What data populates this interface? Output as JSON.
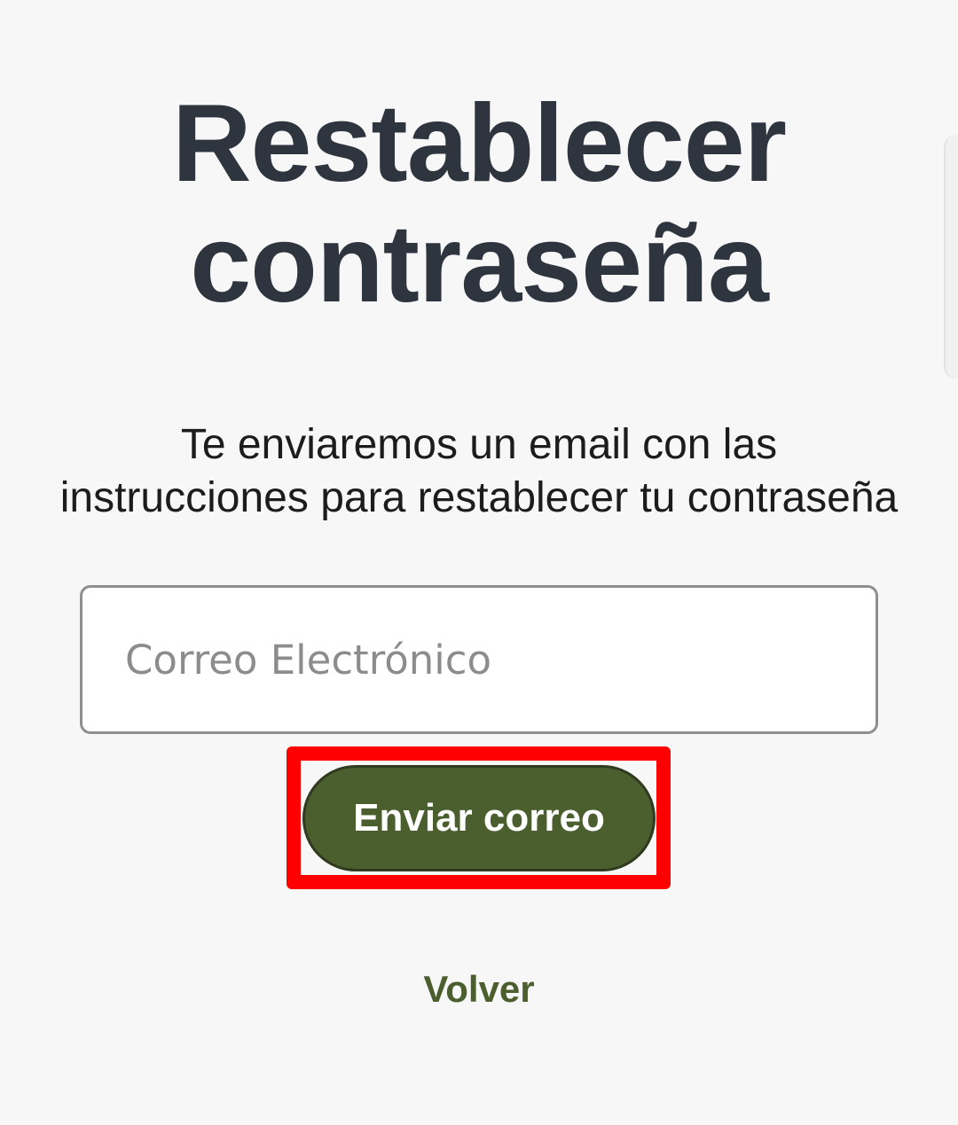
{
  "header": {
    "title_line1": "Restablecer",
    "title_line2": "contraseña"
  },
  "description": {
    "line1": "Te enviaremos un email con las",
    "line2": "instrucciones para restablecer tu contraseña"
  },
  "form": {
    "email": {
      "placeholder": "Correo Electrónico",
      "value": ""
    },
    "submit_label": "Enviar correo",
    "back_label": "Volver"
  },
  "colors": {
    "background": "#f7f7f7",
    "title": "#2e353e",
    "accent": "#4b5e2e",
    "highlight": "#ff0000"
  }
}
